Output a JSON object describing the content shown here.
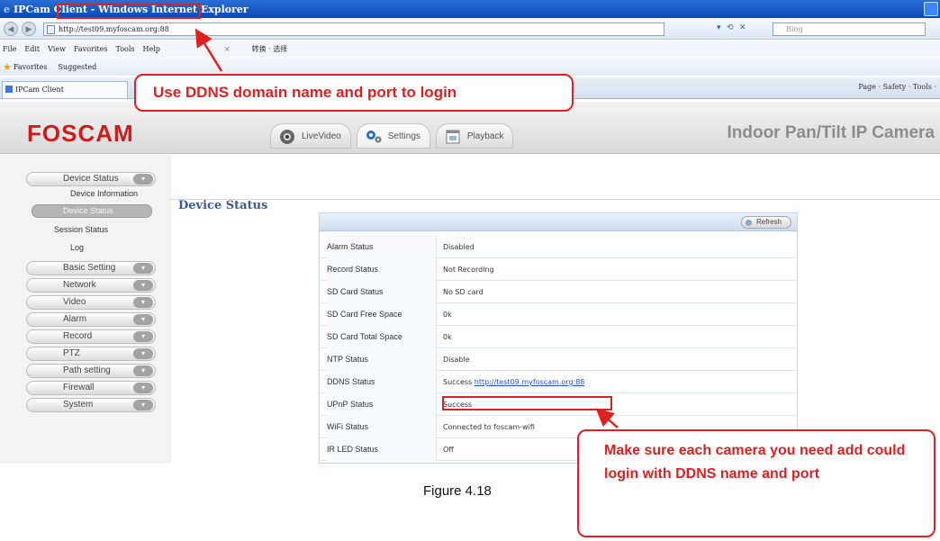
{
  "browser": {
    "title": "IPCam Client - Windows Internet Explorer",
    "url": "http://test09.myfoscam.org:88",
    "search_placeholder": "Bing",
    "menu": [
      "File",
      "Edit",
      "View",
      "Favorites",
      "Tools",
      "Help"
    ],
    "toolbar_cn": "转换 · 选择",
    "favorites_label": "Favorites",
    "suggested_label": "Suggested",
    "tab_title": "IPCam Client",
    "tab_commands": "Page · Safety · Tools ·"
  },
  "app": {
    "logo": "FOSCAM",
    "product": "Indoor Pan/Tilt IP Camera",
    "nav_tabs": [
      {
        "label": "LiveVideo",
        "icon": "live-video-icon"
      },
      {
        "label": "Settings",
        "icon": "settings-icon"
      },
      {
        "label": "Playback",
        "icon": "playback-icon"
      }
    ],
    "sidebar": {
      "device_status": "Device Status",
      "sub_items": [
        "Device Information",
        "Device Status",
        "Session Status",
        "Log"
      ],
      "items": [
        "Basic Setting",
        "Network",
        "Video",
        "Alarm",
        "Record",
        "PTZ",
        "Path setting",
        "Firewall",
        "System"
      ]
    },
    "content": {
      "title": "Device Status",
      "refresh_label": "Refresh",
      "rows": [
        {
          "label": "Alarm Status",
          "value": "Disabled"
        },
        {
          "label": "Record Status",
          "value": "Not Recording"
        },
        {
          "label": "SD Card Status",
          "value": "No SD card"
        },
        {
          "label": "SD Card Free Space",
          "value": "0k"
        },
        {
          "label": "SD Card Total Space",
          "value": "0k"
        },
        {
          "label": "NTP Status",
          "value": "Disable"
        },
        {
          "label": "DDNS Status",
          "value": "Success",
          "link": "http://test09.myfoscam.org:88"
        },
        {
          "label": "UPnP Status",
          "value": "Success"
        },
        {
          "label": "WiFi Status",
          "value": "Connected to foscam-wifi"
        },
        {
          "label": "IR LED Status",
          "value": "Off"
        }
      ]
    }
  },
  "annotations": {
    "top_callout": "Use DDNS domain name and port to login",
    "bottom_callout": "Make sure each camera you need add could login with DDNS name and port",
    "figure_caption": "Figure 4.18"
  },
  "colors": {
    "annotation_red": "#e02020",
    "logo_red": "#c81e1e",
    "title_blue": "#3c5a96",
    "link_blue": "#2650d6"
  }
}
